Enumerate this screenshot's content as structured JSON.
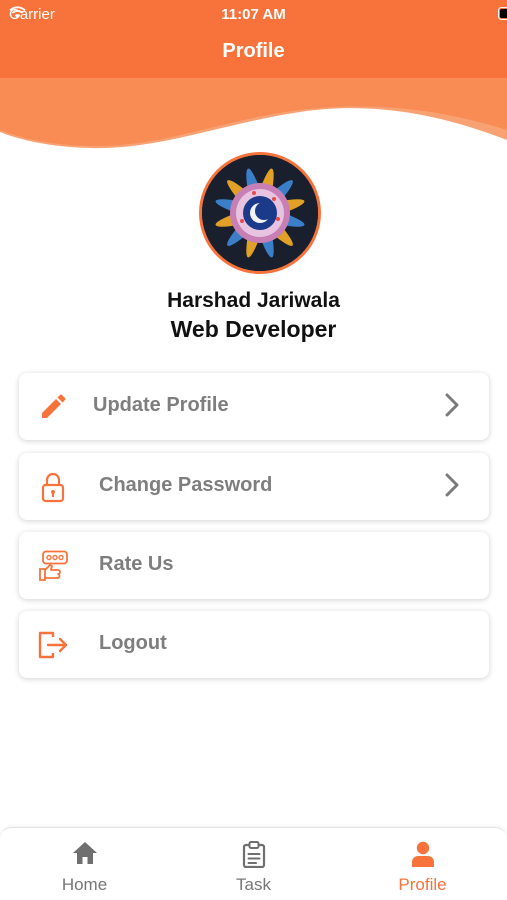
{
  "status_bar": {
    "carrier": "Carrier",
    "time": "11:07 AM"
  },
  "header": {
    "title": "Profile",
    "color": "#f7733b"
  },
  "profile": {
    "name": "Harshad Jariwala",
    "role": "Web Developer",
    "avatar_icon": "mandala-avatar"
  },
  "menu": [
    {
      "label": "Update Profile",
      "icon": "pencil-icon",
      "has_chevron": true
    },
    {
      "label": "Change Password",
      "icon": "lock-icon",
      "has_chevron": true
    },
    {
      "label": "Rate Us",
      "icon": "rate-us-icon",
      "has_chevron": false
    },
    {
      "label": "Logout",
      "icon": "logout-icon",
      "has_chevron": false
    }
  ],
  "tabs": [
    {
      "label": "Home",
      "icon": "home-icon",
      "active": false
    },
    {
      "label": "Task",
      "icon": "clipboard-icon",
      "active": false
    },
    {
      "label": "Profile",
      "icon": "user-icon",
      "active": true
    }
  ],
  "colors": {
    "accent": "#f7733b",
    "muted_text": "#7e7e7e"
  }
}
